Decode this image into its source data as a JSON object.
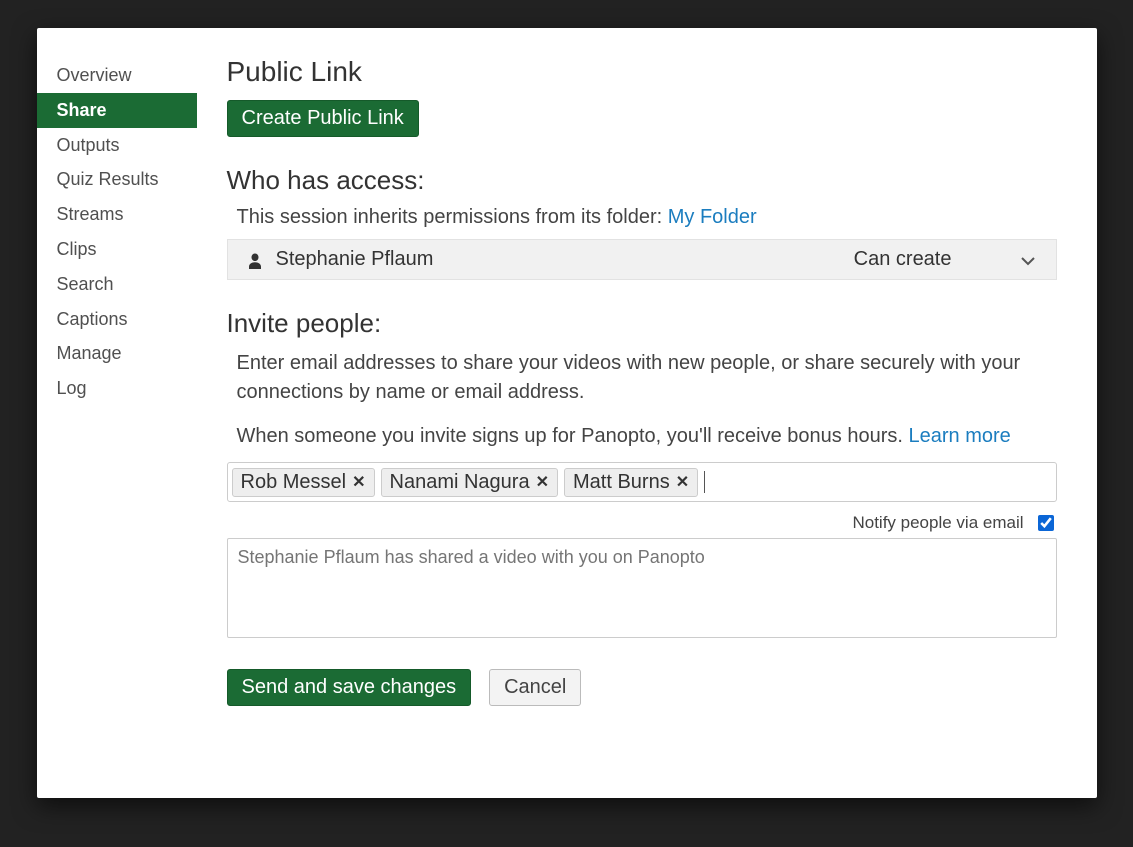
{
  "sidebar": {
    "items": [
      {
        "label": "Overview",
        "active": false
      },
      {
        "label": "Share",
        "active": true
      },
      {
        "label": "Outputs",
        "active": false
      },
      {
        "label": "Quiz Results",
        "active": false
      },
      {
        "label": "Streams",
        "active": false
      },
      {
        "label": "Clips",
        "active": false
      },
      {
        "label": "Search",
        "active": false
      },
      {
        "label": "Captions",
        "active": false
      },
      {
        "label": "Manage",
        "active": false
      },
      {
        "label": "Log",
        "active": false
      }
    ]
  },
  "public_link": {
    "heading": "Public Link",
    "create_button": "Create Public Link"
  },
  "access": {
    "heading": "Who has access:",
    "inherit_text": "This session inherits permissions from its folder: ",
    "folder_link": "My Folder",
    "rows": [
      {
        "name": "Stephanie Pflaum",
        "role": "Can create"
      }
    ]
  },
  "invite": {
    "heading": "Invite people:",
    "instructions": "Enter email addresses to share your videos with new people, or share securely with your connections by name or email address.",
    "bonus_text": "When someone you invite signs up for Panopto, you'll receive bonus hours.  ",
    "learn_more": "Learn more",
    "chips": [
      {
        "label": "Rob Messel"
      },
      {
        "label": "Nanami Nagura"
      },
      {
        "label": "Matt Burns"
      }
    ],
    "notify_label": "Notify people via email",
    "notify_checked": true,
    "message_placeholder": "Stephanie Pflaum has shared a video with you on Panopto"
  },
  "actions": {
    "send": "Send and save changes",
    "cancel": "Cancel"
  }
}
